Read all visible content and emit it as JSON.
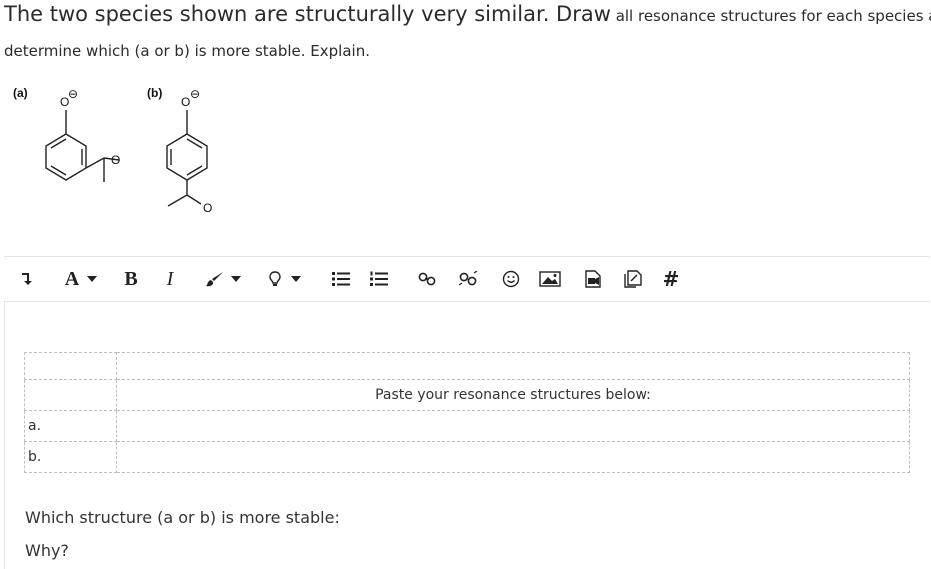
{
  "question": {
    "part1_large": "The two species shown are structurally very similar. Draw",
    "part1_small": " all resonance structures for each species and",
    "line2": "determine which (a or b) is more stable. Explain."
  },
  "molecules": [
    {
      "label": "(a)",
      "charge": "⊖",
      "atoms": [
        "O",
        "O"
      ]
    },
    {
      "label": "(b)",
      "charge": "⊖",
      "atoms": [
        "O",
        "O"
      ]
    }
  ],
  "toolbar": {
    "items": [
      {
        "name": "collapse-toolbar-button",
        "icon": "arrow-down-icon"
      },
      {
        "name": "font-size-button",
        "label": "A",
        "icon": "caret-down-icon"
      },
      {
        "name": "bold-button",
        "label": "B"
      },
      {
        "name": "italic-button",
        "label": "I"
      },
      {
        "name": "text-color-button",
        "icon": "brush-icon"
      },
      {
        "name": "highlight-button",
        "icon": "bulb-icon"
      },
      {
        "name": "unordered-list-button",
        "icon": "bullet-list-icon"
      },
      {
        "name": "ordered-list-button",
        "icon": "numbered-list-icon"
      },
      {
        "name": "insert-link-button",
        "icon": "link-icon"
      },
      {
        "name": "unlink-button",
        "icon": "unlink-icon"
      },
      {
        "name": "emoji-button",
        "icon": "smiley-icon"
      },
      {
        "name": "insert-image-button",
        "icon": "image-icon"
      },
      {
        "name": "insert-media-button",
        "icon": "media-icon"
      },
      {
        "name": "manage-files-button",
        "icon": "files-icon"
      },
      {
        "name": "equation-button",
        "label": "#"
      }
    ]
  },
  "editor": {
    "table": {
      "header": "Paste your resonance structures below:",
      "rows": [
        "a.",
        "b."
      ]
    },
    "question_stable": "Which structure (a or b) is more stable:",
    "question_why": "Why?"
  }
}
